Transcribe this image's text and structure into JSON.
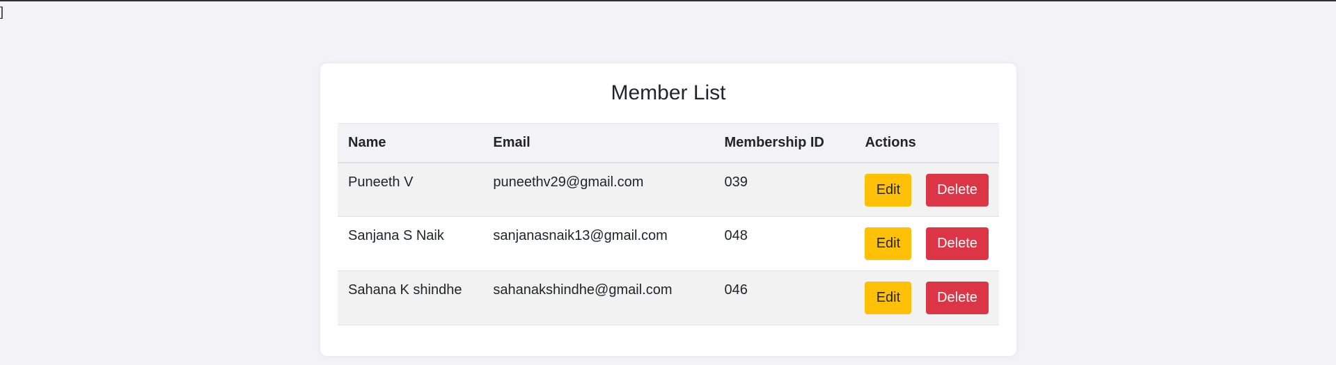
{
  "page": {
    "stray_text": "]"
  },
  "card": {
    "title": "Member List"
  },
  "table": {
    "headers": {
      "name": "Name",
      "email": "Email",
      "membership_id": "Membership ID",
      "actions": "Actions"
    },
    "rows": [
      {
        "name": "Puneeth V",
        "email": "puneethv29@gmail.com",
        "membership_id": "039",
        "edit_label": "Edit",
        "delete_label": "Delete"
      },
      {
        "name": "Sanjana S Naik",
        "email": "sanjanasnaik13@gmail.com",
        "membership_id": "048",
        "edit_label": "Edit",
        "delete_label": "Delete"
      },
      {
        "name": "Sahana K shindhe",
        "email": "sahanakshindhe@gmail.com",
        "membership_id": "046",
        "edit_label": "Edit",
        "delete_label": "Delete"
      }
    ]
  },
  "colors": {
    "edit_button": "#ffc107",
    "delete_button": "#dc3545",
    "page_background": "#f3f3f7",
    "card_background": "#ffffff"
  }
}
